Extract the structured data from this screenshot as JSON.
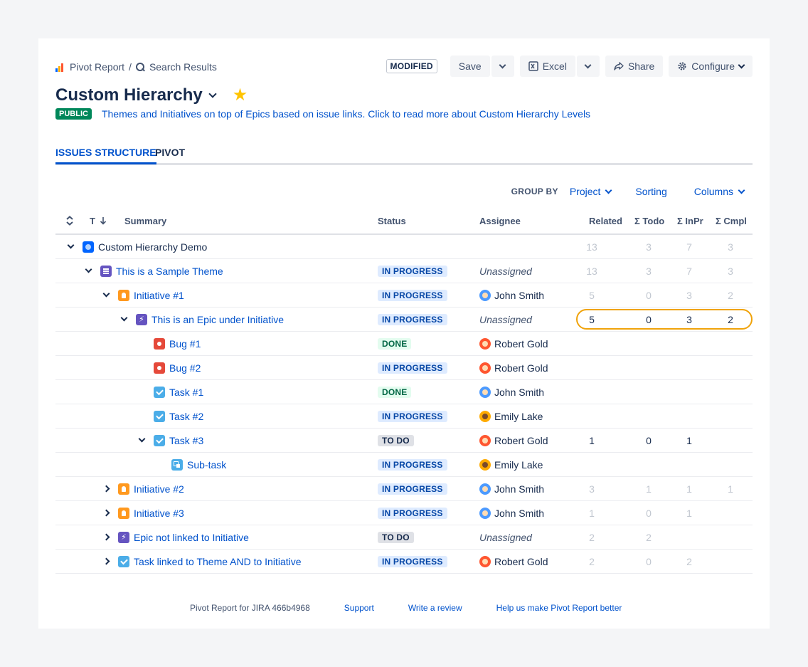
{
  "breadcrumb": {
    "root": "Pivot Report",
    "separator": "/",
    "current": "Search Results"
  },
  "toolbar": {
    "modified": "MODIFIED",
    "save": "Save",
    "excel": "Excel",
    "share": "Share",
    "configure": "Configure"
  },
  "report": {
    "title": "Custom Hierarchy",
    "visibility": "PUBLIC",
    "description": "Themes and Initiatives on top of Epics based on issue links. Click to read more about Custom Hierarchy Levels"
  },
  "tabs": [
    {
      "label": "ISSUES STRUCTURE"
    },
    {
      "label": "PIVOT"
    }
  ],
  "group_by": {
    "label": "GROUP BY",
    "project": "Project",
    "sorting": "Sorting",
    "columns": "Columns"
  },
  "columns": {
    "type": "T",
    "summary": "Summary",
    "status": "Status",
    "assignee": "Assignee",
    "related": "Related",
    "todo": "Σ Todo",
    "inpr": "Σ InPr",
    "cmpl": "Σ Cmpl"
  },
  "rows": [
    {
      "level": 0,
      "expander": "down",
      "type": "project",
      "summary": "Custom Hierarchy Demo",
      "status": "",
      "assignee": "",
      "related": "13",
      "todo": "3",
      "inpr": "7",
      "cmpl": "3",
      "dim": true
    },
    {
      "level": 1,
      "expander": "down",
      "type": "theme",
      "summary": "This is a Sample Theme",
      "status": "IN PROGRESS",
      "assignee": "Unassigned",
      "related": "13",
      "todo": "3",
      "inpr": "7",
      "cmpl": "3",
      "dim": true
    },
    {
      "level": 2,
      "expander": "down",
      "type": "initiative",
      "summary": "Initiative #1",
      "status": "IN PROGRESS",
      "assignee": "John Smith",
      "related": "5",
      "todo": "0",
      "inpr": "3",
      "cmpl": "2",
      "dim": true
    },
    {
      "level": 3,
      "expander": "down",
      "type": "epic",
      "summary": "This is an Epic under Initiative",
      "status": "IN PROGRESS",
      "assignee": "Unassigned",
      "related": "5",
      "todo": "0",
      "inpr": "3",
      "cmpl": "2",
      "dim": false
    },
    {
      "level": 4,
      "expander": "",
      "type": "bug",
      "summary": "Bug #1",
      "status": "DONE",
      "assignee": "Robert Gold",
      "related": "",
      "todo": "",
      "inpr": "",
      "cmpl": "",
      "dim": false
    },
    {
      "level": 4,
      "expander": "",
      "type": "bug",
      "summary": "Bug #2",
      "status": "IN PROGRESS",
      "assignee": "Robert Gold",
      "related": "",
      "todo": "",
      "inpr": "",
      "cmpl": "",
      "dim": false
    },
    {
      "level": 4,
      "expander": "",
      "type": "task",
      "summary": "Task #1",
      "status": "DONE",
      "assignee": "John Smith",
      "related": "",
      "todo": "",
      "inpr": "",
      "cmpl": "",
      "dim": false
    },
    {
      "level": 4,
      "expander": "",
      "type": "task",
      "summary": "Task #2",
      "status": "IN PROGRESS",
      "assignee": "Emily Lake",
      "related": "",
      "todo": "",
      "inpr": "",
      "cmpl": "",
      "dim": false
    },
    {
      "level": 4,
      "expander": "down",
      "type": "task",
      "summary": "Task #3",
      "status": "TO DO",
      "assignee": "Robert Gold",
      "related": "1",
      "todo": "0",
      "inpr": "1",
      "cmpl": "",
      "dim": false
    },
    {
      "level": 5,
      "expander": "",
      "type": "subtask",
      "summary": "Sub-task",
      "status": "IN PROGRESS",
      "assignee": "Emily Lake",
      "related": "",
      "todo": "",
      "inpr": "",
      "cmpl": "",
      "dim": false
    },
    {
      "level": 2,
      "expander": "right",
      "type": "initiative",
      "summary": "Initiative #2",
      "status": "IN PROGRESS",
      "assignee": "John Smith",
      "related": "3",
      "todo": "1",
      "inpr": "1",
      "cmpl": "1",
      "dim": true
    },
    {
      "level": 2,
      "expander": "right",
      "type": "initiative",
      "summary": "Initiative #3",
      "status": "IN PROGRESS",
      "assignee": "John Smith",
      "related": "1",
      "todo": "0",
      "inpr": "1",
      "cmpl": "",
      "dim": true
    },
    {
      "level": 2,
      "expander": "right",
      "type": "epic",
      "summary": "Epic not linked to Initiative",
      "status": "TO DO",
      "assignee": "Unassigned",
      "related": "2",
      "todo": "2",
      "inpr": "",
      "cmpl": "",
      "dim": true
    },
    {
      "level": 2,
      "expander": "right",
      "type": "task",
      "summary": "Task linked to Theme AND to Initiative",
      "status": "IN PROGRESS",
      "assignee": "Robert Gold",
      "related": "2",
      "todo": "0",
      "inpr": "2",
      "cmpl": "",
      "dim": true
    }
  ],
  "footer": {
    "version": "Pivot Report for JIRA 466b4968",
    "support": "Support",
    "review": "Write a review",
    "feedback": "Help us make Pivot Report better"
  },
  "colors": {
    "link": "#0052cc",
    "highlight": "#f0a30a",
    "public": "#00875a"
  }
}
